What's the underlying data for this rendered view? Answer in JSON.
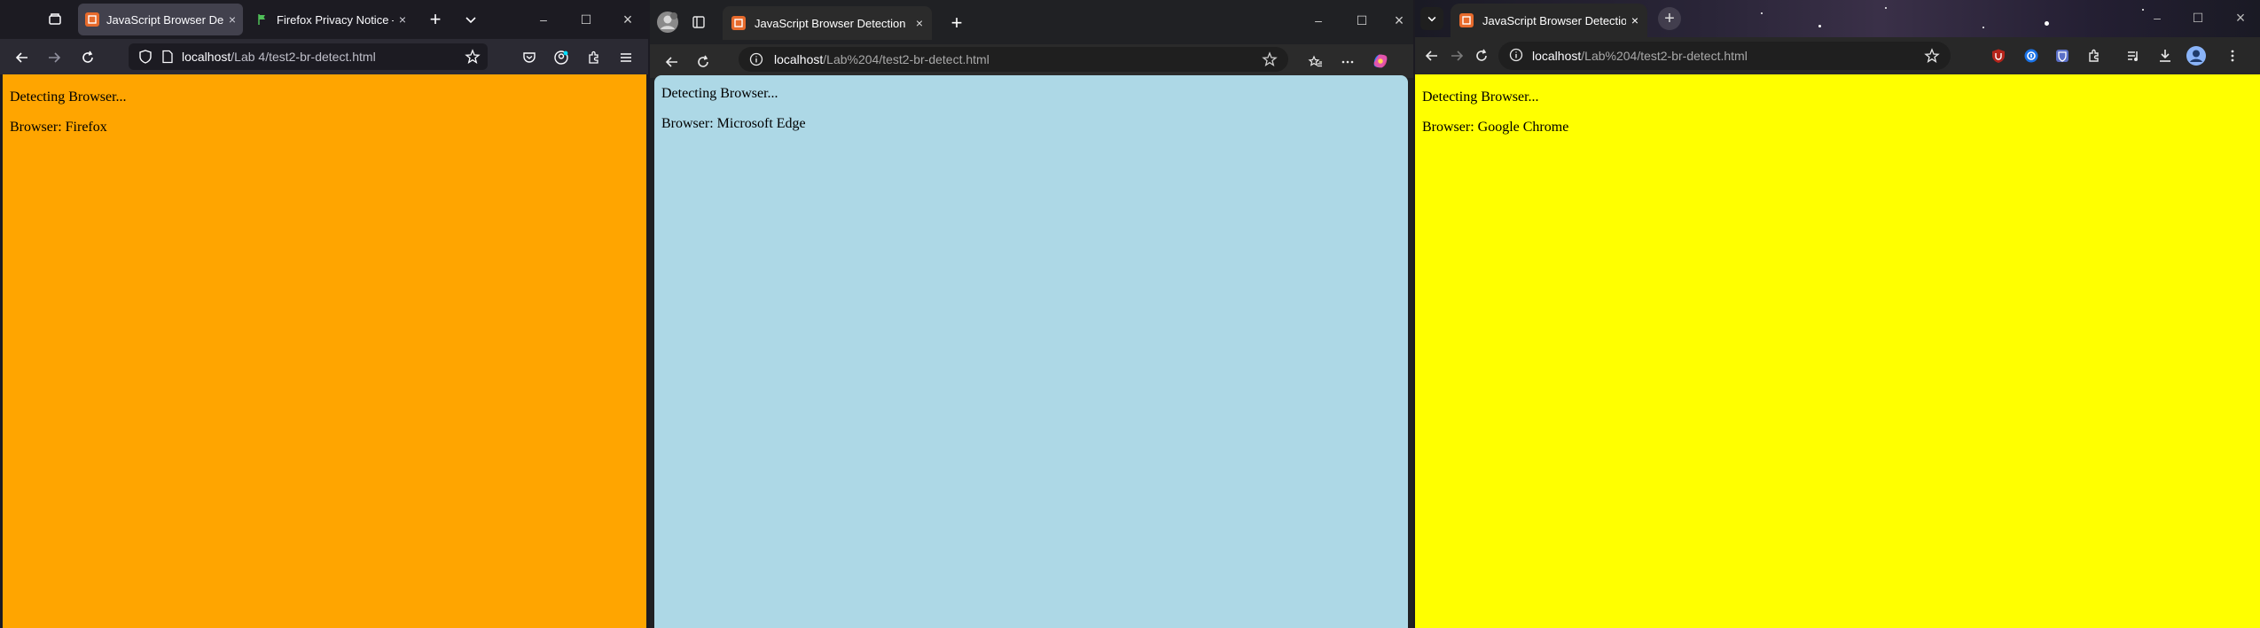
{
  "firefox": {
    "tabs": [
      {
        "title": "JavaScript Browser Detect",
        "active": true
      },
      {
        "title": "Firefox Privacy Notice —",
        "active": false
      }
    ],
    "url": {
      "host": "localhost",
      "path": "/Lab 4/test2-br-detect.html"
    },
    "page": {
      "line1": "Detecting Browser...",
      "line2": "Browser: Firefox",
      "bg": "#ffa500"
    }
  },
  "edge": {
    "tabs": [
      {
        "title": "JavaScript Browser Detection",
        "active": true
      }
    ],
    "url": {
      "host": "localhost",
      "path": "/Lab%204/test2-br-detect.html"
    },
    "page": {
      "line1": "Detecting Browser...",
      "line2": "Browser: Microsoft Edge",
      "bg": "#add8e6"
    }
  },
  "chrome": {
    "tabs": [
      {
        "title": "JavaScript Browser Detection",
        "active": true
      }
    ],
    "url": {
      "host": "localhost",
      "path": "/Lab%204/test2-br-detect.html"
    },
    "page": {
      "line1": "Detecting Browser...",
      "line2": "Browser: Google Chrome",
      "bg": "#ffff00"
    }
  },
  "icons": {
    "close": "×",
    "new_tab": "+",
    "minimize": "–",
    "maximize": "☐",
    "chevron": "⌄"
  }
}
